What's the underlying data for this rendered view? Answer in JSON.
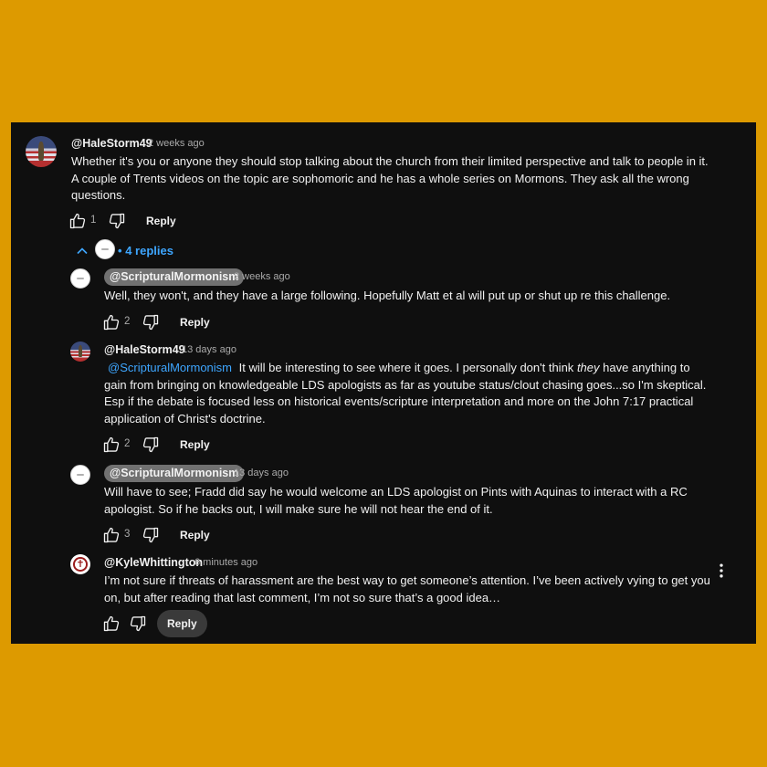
{
  "thread": {
    "top_comment": {
      "author": "@HaleStorm49",
      "time": "2 weeks ago",
      "text_lines": [
        "Whether it's you or anyone they should stop talking about the church from their limited perspective and talk to people in it.",
        "A couple of Trents videos on the topic are sophomoric and he has a whole series on Mormons. They ask all the wrong",
        "questions."
      ],
      "likes": "1",
      "reply_label": "Reply"
    },
    "replies_toggle": {
      "bullet": "•",
      "label": "4 replies"
    },
    "replies": [
      {
        "author": "@ScripturalMormonism",
        "time": "2 weeks ago",
        "text_lines": [
          "Well, they won't, and they have a large following. Hopefully Matt et al will put up or shut up re this challenge."
        ],
        "likes": "2",
        "reply_label": "Reply"
      },
      {
        "author": "@HaleStorm49",
        "time": "13 days ago",
        "mention": "@ScripturalMormonism",
        "line1_before_em": "It will be interesting to see where it goes.  I personally don't think",
        "line1_em": "they",
        "line1_after_em": "have anything to",
        "text_lines": [
          "gain from bringing on knowledgeable LDS apologists as far as youtube status/clout chasing goes...so I'm skeptical.",
          "Esp if the debate is focused less on historical events/scripture interpretation and more on the John 7:17 practical",
          "application of Christ's doctrine."
        ],
        "likes": "2",
        "reply_label": "Reply"
      },
      {
        "author": "@ScripturalMormonism",
        "time": "13 days ago",
        "text_lines": [
          "Will have to see; Fradd did say he would welcome an LDS apologist on Pints with Aquinas to interact with a RC",
          "apologist. So if he backs out, I will make sure he will not hear the end of it."
        ],
        "likes": "3",
        "reply_label": "Reply"
      },
      {
        "author": "@KyleWhittington",
        "time": "6 minutes ago",
        "text_lines": [
          "I’m not sure if threats of harassment are the best way to get someone’s attention. I’ve been actively vying to get you",
          "on, but after reading that last comment, I’m not so sure that’s a good idea…"
        ],
        "reply_label": "Reply"
      }
    ]
  },
  "icons": [
    "thumbs-up-icon",
    "thumbs-down-icon",
    "chevron-up-icon",
    "more-vert-icon"
  ],
  "colors": {
    "background": "#dd9a00",
    "panel": "#0f0f0f",
    "text": "#f1f1f1",
    "secondary_text": "#aaaaaa",
    "link": "#3ea6ff",
    "author_chip": "#717171",
    "reply_pill": "#3a3a3a"
  }
}
